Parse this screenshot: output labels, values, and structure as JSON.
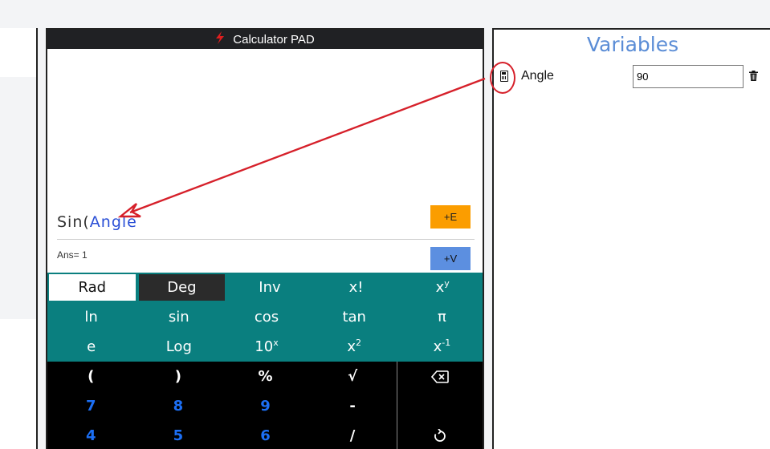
{
  "calculator": {
    "title": "Calculator PAD",
    "expression_prefix": "Sin(",
    "expression_var": "Angle",
    "add_expression_label": "+E",
    "add_variable_label": "+V",
    "answer": "Ans= 1"
  },
  "teal_keys": [
    [
      {
        "label": "Rad"
      },
      {
        "label": "Deg"
      },
      {
        "label": "Inv"
      },
      {
        "label": "x!"
      },
      {
        "label": "x",
        "sup": "y"
      }
    ],
    [
      {
        "label": "ln"
      },
      {
        "label": "sin"
      },
      {
        "label": "cos"
      },
      {
        "label": "tan"
      },
      {
        "label": "π"
      }
    ],
    [
      {
        "label": "e"
      },
      {
        "label": "Log"
      },
      {
        "label": "10",
        "sup": "x"
      },
      {
        "label": "x",
        "sup": "2"
      },
      {
        "label": "x",
        "sup": "-1"
      }
    ]
  ],
  "black_keys": [
    [
      "(",
      ")",
      "%",
      "√",
      "⌫"
    ],
    [
      "7",
      "8",
      "9",
      "-",
      ""
    ],
    [
      "4",
      "5",
      "6",
      "/",
      "↻"
    ]
  ],
  "variables": {
    "title": "Variables",
    "items": [
      {
        "name": "Angle",
        "value": "90"
      }
    ]
  },
  "colors": {
    "teal": "#0a7f7f",
    "orange": "#fb9d00",
    "blue_button": "#5c8fe0",
    "title_blue": "#5b8dd6",
    "annotation_red": "#d6202a"
  }
}
